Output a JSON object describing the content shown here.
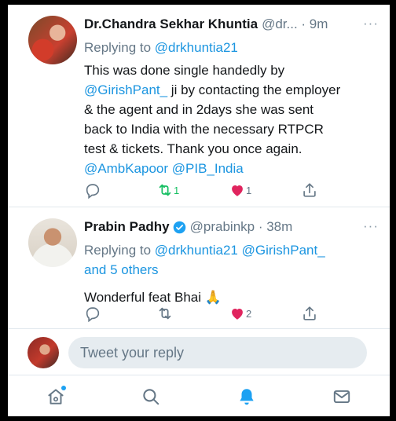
{
  "tweets": [
    {
      "name": "Dr.Chandra Sekhar Khuntia",
      "handle_time": "@dr... · 9m",
      "more": "···",
      "replying_prefix": "Replying to ",
      "replying_to": "@drkhuntia21",
      "body_line1": "This was done single handedly by",
      "mention1": "@GirishPant_",
      "body_line2_rest": " ji by contacting the employer",
      "body_line3": "& the agent and in 2days she was sent",
      "body_line4": "back to India with the necessary RTPCR",
      "body_line5": "test & tickets. Thank you once again.",
      "mention2": "@AmbKapoor",
      "mention3": "@PIB_India",
      "retweet_count": "1",
      "like_count": "1"
    },
    {
      "name": "Prabin Padhy",
      "handle_time": "@prabinkp · 38m",
      "more": "···",
      "replying_prefix": "Replying to ",
      "replying_to": "@drkhuntia21 @GirishPant_",
      "replying_more": "and 5 others",
      "body": "Wonderful feat Bhai 🙏",
      "retweet_count": "",
      "like_count": "2"
    }
  ],
  "composer": {
    "placeholder": "Tweet your reply"
  },
  "tabs": [
    "home-icon",
    "search-icon",
    "notifications-icon",
    "messages-icon"
  ],
  "colors": {
    "accent": "#1da1f2",
    "link": "#1b95e0",
    "retweet": "#17bf63",
    "like": "#e0245e",
    "muted": "#657786"
  }
}
